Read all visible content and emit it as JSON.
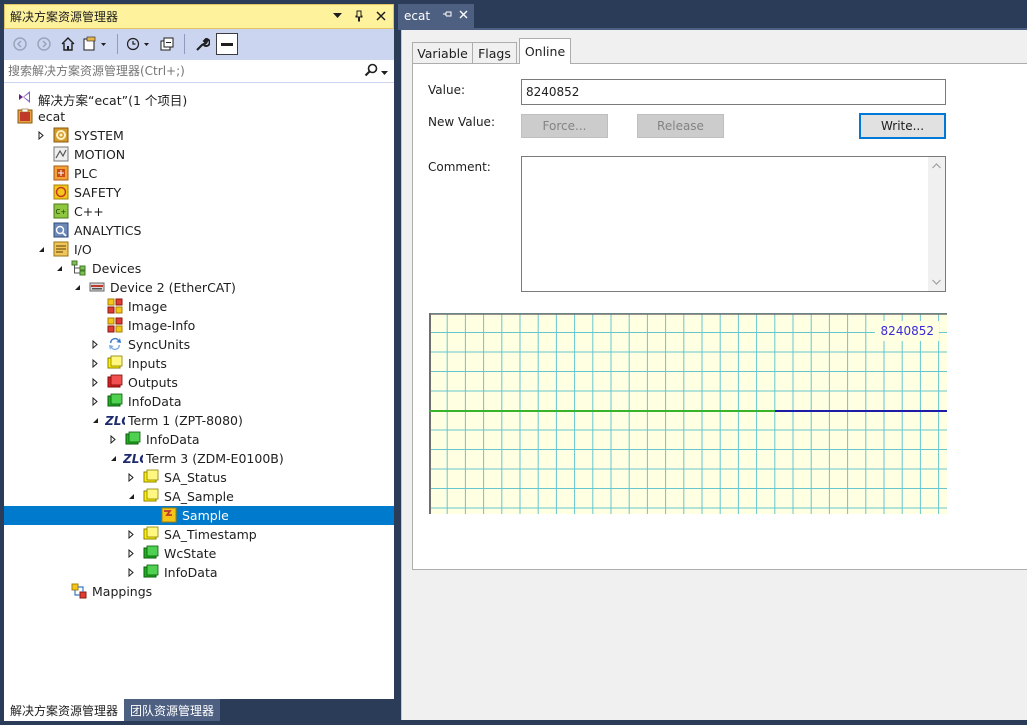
{
  "solution_explorer": {
    "title": "解决方案资源管理器",
    "search_placeholder": "搜索解决方案资源管理器(Ctrl+;)",
    "title_buttons": [
      "dropdown-icon",
      "pin-icon",
      "close-icon"
    ],
    "tree": [
      {
        "label": "解决方案“ecat”(1 个项目)",
        "level": 0,
        "expander": "none",
        "icon": "vs-solution-icon"
      },
      {
        "label": "ecat",
        "level": 0,
        "expander": "expanded",
        "icon": "twincat-project-icon"
      },
      {
        "label": "SYSTEM",
        "level": 1,
        "expander": "collapsed",
        "icon": "system-icon"
      },
      {
        "label": "MOTION",
        "level": 1,
        "expander": "none",
        "icon": "motion-icon"
      },
      {
        "label": "PLC",
        "level": 1,
        "expander": "none",
        "icon": "plc-icon"
      },
      {
        "label": "SAFETY",
        "level": 1,
        "expander": "none",
        "icon": "safety-icon"
      },
      {
        "label": "C++",
        "level": 1,
        "expander": "none",
        "icon": "cpp-icon"
      },
      {
        "label": "ANALYTICS",
        "level": 1,
        "expander": "none",
        "icon": "analytics-icon"
      },
      {
        "label": "I/O",
        "level": 1,
        "expander": "expanded",
        "icon": "io-icon"
      },
      {
        "label": "Devices",
        "level": 2,
        "expander": "expanded",
        "icon": "devices-icon"
      },
      {
        "label": "Device 2 (EtherCAT)",
        "level": 3,
        "expander": "expanded",
        "icon": "ethercat-device-icon"
      },
      {
        "label": "Image",
        "level": 4,
        "expander": "none",
        "icon": "image-icon"
      },
      {
        "label": "Image-Info",
        "level": 4,
        "expander": "none",
        "icon": "image-info-icon"
      },
      {
        "label": "SyncUnits",
        "level": 4,
        "expander": "collapsed",
        "icon": "syncunits-icon"
      },
      {
        "label": "Inputs",
        "level": 4,
        "expander": "collapsed",
        "icon": "inputs-icon"
      },
      {
        "label": "Outputs",
        "level": 4,
        "expander": "collapsed",
        "icon": "outputs-icon"
      },
      {
        "label": "InfoData",
        "level": 4,
        "expander": "collapsed",
        "icon": "infodata-icon"
      },
      {
        "label": "Term 1 (ZPT-8080)",
        "level": 4,
        "expander": "expanded",
        "icon": "zlg-terminal-icon"
      },
      {
        "label": "InfoData",
        "level": 5,
        "expander": "collapsed",
        "icon": "infodata-icon"
      },
      {
        "label": "Term 3 (ZDM-E0100B)",
        "level": 5,
        "expander": "expanded",
        "icon": "zlg-terminal-icon"
      },
      {
        "label": "SA_Status",
        "level": 6,
        "expander": "collapsed",
        "icon": "inputs-icon"
      },
      {
        "label": "SA_Sample",
        "level": 6,
        "expander": "expanded",
        "icon": "inputs-icon"
      },
      {
        "label": "Sample",
        "level": 7,
        "expander": "none",
        "icon": "variable-icon",
        "selected": true
      },
      {
        "label": "SA_Timestamp",
        "level": 6,
        "expander": "collapsed",
        "icon": "inputs-icon"
      },
      {
        "label": "WcState",
        "level": 6,
        "expander": "collapsed",
        "icon": "infodata-icon"
      },
      {
        "label": "InfoData",
        "level": 6,
        "expander": "collapsed",
        "icon": "infodata-icon"
      },
      {
        "label": "Mappings",
        "level": 2,
        "expander": "none",
        "icon": "mappings-icon"
      }
    ],
    "bottom_tabs": [
      "解决方案资源管理器",
      "团队资源管理器"
    ]
  },
  "document": {
    "tab_title": "ecat",
    "prop_tabs": [
      "Variable",
      "Flags",
      "Online"
    ],
    "active_prop_tab": "Online",
    "value_label": "Value:",
    "value": "8240852",
    "new_value_label": "New Value:",
    "force_label": "Force...",
    "release_label": "Release",
    "write_label": "Write...",
    "comment_label": "Comment:",
    "comment": "",
    "scope_value": "8240852"
  },
  "colors": {
    "accent": "#007acc",
    "title_active": "#fff29d",
    "green_trace": "#38b42c",
    "blue_trace": "#1c1ca8",
    "grid_line": "#66c6cf",
    "scope_bg": "#ffffe2"
  }
}
